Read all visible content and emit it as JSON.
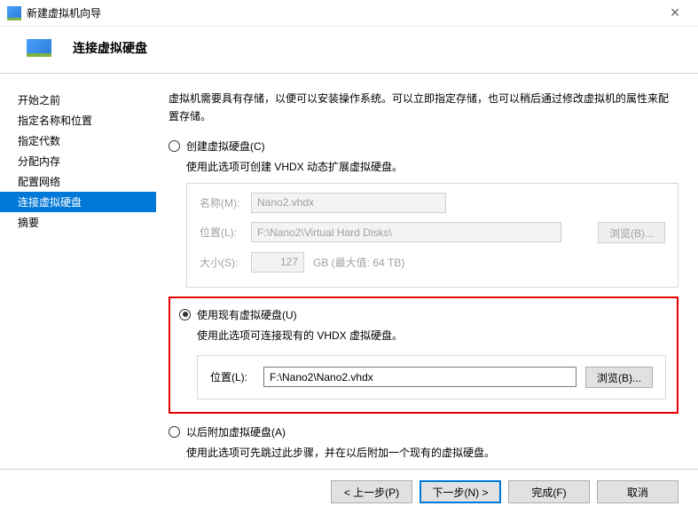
{
  "window": {
    "title": "新建虚拟机向导"
  },
  "header": {
    "title": "连接虚拟硬盘"
  },
  "sidebar": {
    "items": [
      {
        "label": "开始之前"
      },
      {
        "label": "指定名称和位置"
      },
      {
        "label": "指定代数"
      },
      {
        "label": "分配内存"
      },
      {
        "label": "配置网络"
      },
      {
        "label": "连接虚拟硬盘"
      },
      {
        "label": "摘要"
      }
    ],
    "selected_index": 5
  },
  "main": {
    "intro": "虚拟机需要具有存储，以便可以安装操作系统。可以立即指定存储，也可以稍后通过修改虚拟机的属性来配置存储。",
    "option_create": {
      "label": "创建虚拟硬盘(C)",
      "desc": "使用此选项可创建 VHDX 动态扩展虚拟硬盘。",
      "name_label": "名称(M):",
      "name_value": "Nano2.vhdx",
      "loc_label": "位置(L):",
      "loc_value": "F:\\Nano2\\Virtual Hard Disks\\",
      "browse": "浏览(B)...",
      "size_label": "大小(S):",
      "size_value": "127",
      "size_suffix": "GB (最大值: 64 TB)"
    },
    "option_use": {
      "label": "使用现有虚拟硬盘(U)",
      "desc": "使用此选项可连接现有的 VHDX 虚拟硬盘。",
      "loc_label": "位置(L):",
      "loc_value": "F:\\Nano2\\Nano2.vhdx",
      "browse": "浏览(B)..."
    },
    "option_later": {
      "label": "以后附加虚拟硬盘(A)",
      "desc": "使用此选项可先跳过此步骤，并在以后附加一个现有的虚拟硬盘。"
    }
  },
  "footer": {
    "back": "< 上一步(P)",
    "next": "下一步(N) >",
    "finish": "完成(F)",
    "cancel": "取消"
  }
}
